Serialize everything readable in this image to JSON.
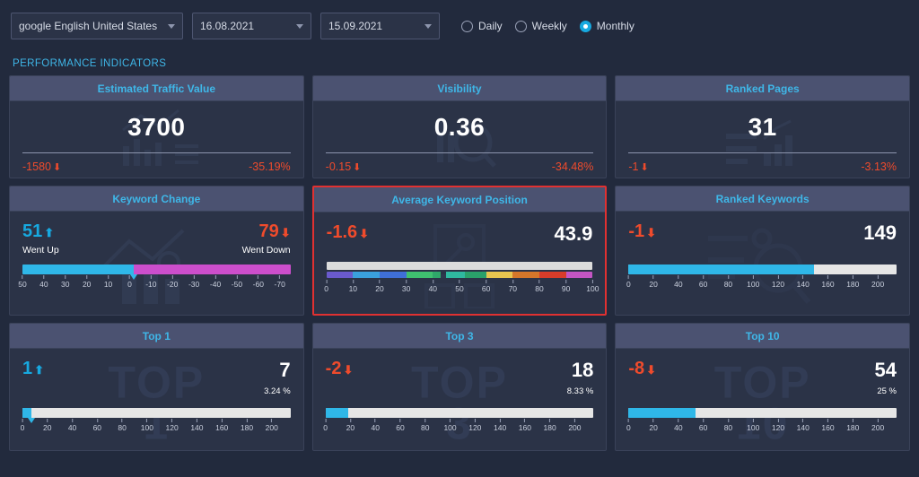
{
  "toolbar": {
    "search_engine": "google English United States",
    "date_from": "16.08.2021",
    "date_to": "15.09.2021",
    "frequency_options": [
      "Daily",
      "Weekly",
      "Monthly"
    ],
    "frequency_selected": "Monthly"
  },
  "section": {
    "title": "PERFORMANCE INDICATORS"
  },
  "colors": {
    "accent_cyan": "#3fb7e8",
    "down_red": "#ef4b2c",
    "up_blue": "#17a9e0",
    "bar_cyan": "#2fb7e8",
    "bar_magenta": "#cc4ecc",
    "highlight_border": "#e03131",
    "card_header": "#4b5271",
    "card_body": "#2b3347",
    "page_bg": "#222a3d"
  },
  "kpi_cards": [
    {
      "title": "Estimated Traffic Value",
      "value": "3700",
      "delta": "-1580",
      "delta_arrow": "down",
      "percent": "-35.19%",
      "icon": "bar-chart-icon"
    },
    {
      "title": "Visibility",
      "value": "0.36",
      "delta": "-0.15",
      "delta_arrow": "down",
      "percent": "-34.48%",
      "icon": "magnifier-icon"
    },
    {
      "title": "Ranked Pages",
      "value": "31",
      "delta": "-1",
      "delta_arrow": "down",
      "percent": "-3.13%",
      "icon": "pages-chart-icon"
    }
  ],
  "keyword_change": {
    "title": "Keyword Change",
    "up_value": "51",
    "up_label": "Went Up",
    "down_value": "79",
    "down_label": "Went Down",
    "ticks": [
      "50",
      "40",
      "30",
      "20",
      "10",
      "0",
      "-10",
      "-20",
      "-30",
      "-40",
      "-50",
      "-60",
      "-70"
    ],
    "icon": "trend-line-icon"
  },
  "average_keyword_position": {
    "title": "Average Keyword Position",
    "delta": "-1.6",
    "delta_arrow": "down",
    "value": "43.9",
    "ticks": [
      "0",
      "10",
      "20",
      "30",
      "40",
      "50",
      "60",
      "70",
      "80",
      "90",
      "100"
    ],
    "marker_position": 43.9,
    "icon": "keyword-position-icon",
    "highlighted": true
  },
  "ranked_keywords": {
    "title": "Ranked Keywords",
    "delta": "-1",
    "delta_arrow": "down",
    "value": "149",
    "ticks": [
      "0",
      "20",
      "40",
      "60",
      "80",
      "100",
      "120",
      "140",
      "160",
      "180",
      "200"
    ],
    "fill_percent": 69.3,
    "icon": "key-magnifier-icon"
  },
  "top_cards": [
    {
      "title": "Top 1",
      "delta": "1",
      "delta_arrow": "up",
      "value": "7",
      "percent": "3.24 %",
      "fill_percent": 3.3,
      "pointer": true,
      "ticks": [
        "0",
        "20",
        "40",
        "60",
        "80",
        "100",
        "120",
        "140",
        "160",
        "180",
        "200"
      ],
      "watermark": "TOP",
      "watermark_sub": "1"
    },
    {
      "title": "Top 3",
      "delta": "-2",
      "delta_arrow": "down",
      "value": "18",
      "percent": "8.33 %",
      "fill_percent": 8.4,
      "pointer": false,
      "ticks": [
        "0",
        "20",
        "40",
        "60",
        "80",
        "100",
        "120",
        "140",
        "160",
        "180",
        "200"
      ],
      "watermark": "TOP",
      "watermark_sub": "3"
    },
    {
      "title": "Top 10",
      "delta": "-8",
      "delta_arrow": "down",
      "value": "54",
      "percent": "25 %",
      "fill_percent": 25.1,
      "pointer": false,
      "ticks": [
        "0",
        "20",
        "40",
        "60",
        "80",
        "100",
        "120",
        "140",
        "160",
        "180",
        "200"
      ],
      "watermark": "TOP",
      "watermark_sub": "10"
    }
  ],
  "chart_data": {
    "type": "bar",
    "title": "PERFORMANCE INDICATORS",
    "series": [
      {
        "name": "Estimated Traffic Value",
        "value": 3700,
        "change": -1580,
        "change_percent": -35.19
      },
      {
        "name": "Visibility",
        "value": 0.36,
        "change": -0.15,
        "change_percent": -34.48
      },
      {
        "name": "Ranked Pages",
        "value": 31,
        "change": -1,
        "change_percent": -3.13
      },
      {
        "name": "Keyword Change Up",
        "value": 51
      },
      {
        "name": "Keyword Change Down",
        "value": 79
      },
      {
        "name": "Average Keyword Position",
        "value": 43.9,
        "change": -1.6
      },
      {
        "name": "Ranked Keywords",
        "value": 149,
        "change": -1
      },
      {
        "name": "Top 1",
        "value": 7,
        "change": 1,
        "share_percent": 3.24
      },
      {
        "name": "Top 3",
        "value": 18,
        "change": -2,
        "share_percent": 8.33
      },
      {
        "name": "Top 10",
        "value": 54,
        "change": -8,
        "share_percent": 25
      }
    ]
  }
}
